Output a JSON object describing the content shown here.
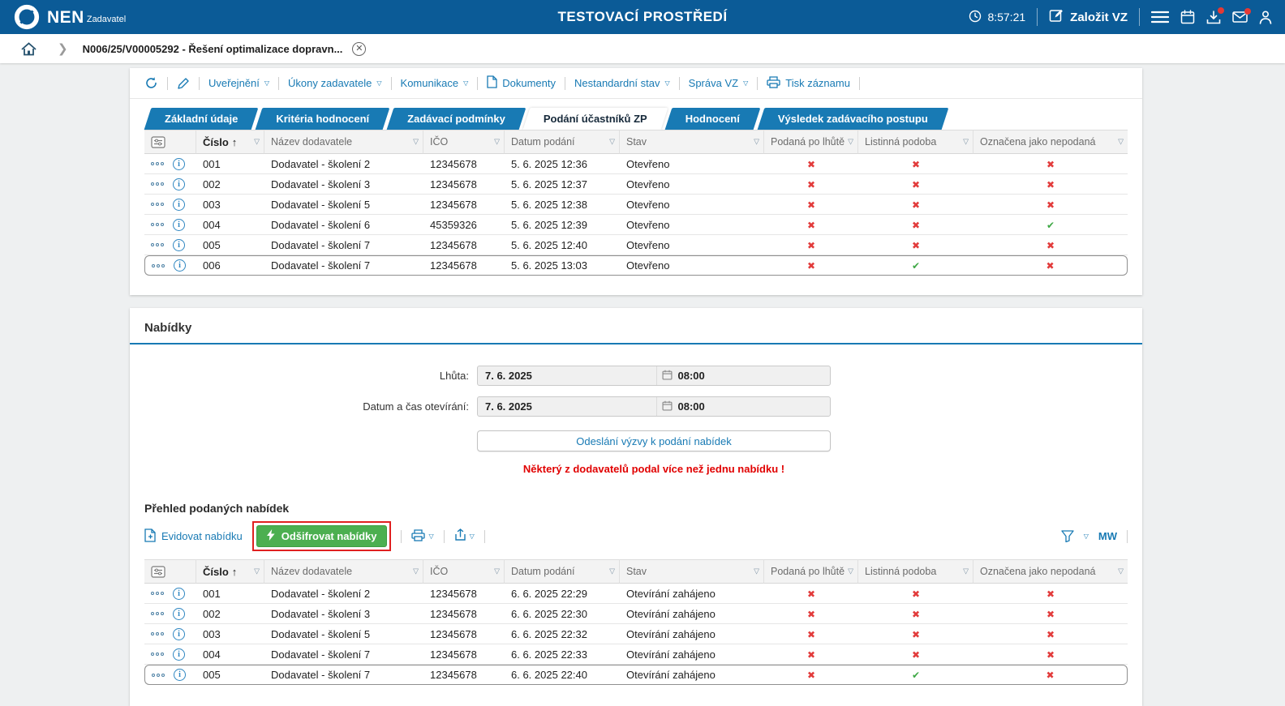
{
  "topbar": {
    "brand": "NEN",
    "brand_sub": "Zadavatel",
    "env_title": "TESTOVACÍ PROSTŘEDÍ",
    "time": "8:57:21",
    "create_vz_label": "Založit VZ"
  },
  "breadcrumb": {
    "record_title": "N006/25/V00005292 - Řešení optimalizace dopravn..."
  },
  "record_toolbar": {
    "items": [
      {
        "label": "Uveřejnění",
        "dropdown": true
      },
      {
        "label": "Úkony zadavatele",
        "dropdown": true
      },
      {
        "label": "Komunikace",
        "dropdown": true
      },
      {
        "label": "Dokumenty",
        "dropdown": false
      },
      {
        "label": "Nestandardní stav",
        "dropdown": true
      },
      {
        "label": "Správa VZ",
        "dropdown": true
      },
      {
        "label": "Tisk záznamu",
        "dropdown": false
      }
    ]
  },
  "tabs": [
    {
      "label": "Základní údaje",
      "active": false
    },
    {
      "label": "Kritéria hodnocení",
      "active": false
    },
    {
      "label": "Zadávací podmínky",
      "active": false
    },
    {
      "label": "Podání účastníků ZP",
      "active": true
    },
    {
      "label": "Hodnocení",
      "active": false
    },
    {
      "label": "Výsledek zadávacího postupu",
      "active": false
    }
  ],
  "headers": [
    "Číslo",
    "Název dodavatele",
    "IČO",
    "Datum podání",
    "Stav",
    "Podaná po lhůtě",
    "Listinná podoba",
    "Označena jako nepodaná"
  ],
  "participants_table": {
    "rows": [
      {
        "number": "001",
        "supplier": "Dodavatel - školení 2",
        "ico": "12345678",
        "submitted": "5. 6. 2025 12:36",
        "status": "Otevřeno",
        "late": false,
        "paper": false,
        "not_submitted": false,
        "selected": false
      },
      {
        "number": "002",
        "supplier": "Dodavatel - školení 3",
        "ico": "12345678",
        "submitted": "5. 6. 2025 12:37",
        "status": "Otevřeno",
        "late": false,
        "paper": false,
        "not_submitted": false,
        "selected": false
      },
      {
        "number": "003",
        "supplier": "Dodavatel - školení 5",
        "ico": "12345678",
        "submitted": "5. 6. 2025 12:38",
        "status": "Otevřeno",
        "late": false,
        "paper": false,
        "not_submitted": false,
        "selected": false
      },
      {
        "number": "004",
        "supplier": "Dodavatel - školení 6",
        "ico": "45359326",
        "submitted": "5. 6. 2025 12:39",
        "status": "Otevřeno",
        "late": false,
        "paper": false,
        "not_submitted": true,
        "selected": false
      },
      {
        "number": "005",
        "supplier": "Dodavatel - školení 7",
        "ico": "12345678",
        "submitted": "5. 6. 2025 12:40",
        "status": "Otevřeno",
        "late": false,
        "paper": false,
        "not_submitted": false,
        "selected": false
      },
      {
        "number": "006",
        "supplier": "Dodavatel - školení 7",
        "ico": "12345678",
        "submitted": "5. 6. 2025 13:03",
        "status": "Otevřeno",
        "late": false,
        "paper": true,
        "not_submitted": false,
        "selected": true
      }
    ]
  },
  "offers_section": {
    "title": "Nabídky",
    "deadline_label": "Lhůta:",
    "deadline_date": "7. 6. 2025",
    "deadline_time": "08:00",
    "opening_label": "Datum a čas otevírání:",
    "opening_date": "7. 6. 2025",
    "opening_time": "08:00",
    "send_invitation_label": "Odeslání výzvy k podání nabídek",
    "warning": "Některý z dodavatelů podal více než jednu nabídku !"
  },
  "submitted_offers": {
    "title": "Přehled podaných nabídek",
    "register_label": "Evidovat nabídku",
    "decrypt_label": "Odšifrovat nabídky",
    "mw_label": "MW",
    "rows": [
      {
        "number": "001",
        "supplier": "Dodavatel - školení 2",
        "ico": "12345678",
        "submitted": "6. 6. 2025 22:29",
        "status": "Otevírání zahájeno",
        "late": false,
        "paper": false,
        "not_submitted": false,
        "selected": false
      },
      {
        "number": "002",
        "supplier": "Dodavatel - školení 3",
        "ico": "12345678",
        "submitted": "6. 6. 2025 22:30",
        "status": "Otevírání zahájeno",
        "late": false,
        "paper": false,
        "not_submitted": false,
        "selected": false
      },
      {
        "number": "003",
        "supplier": "Dodavatel - školení 5",
        "ico": "12345678",
        "submitted": "6. 6. 2025 22:32",
        "status": "Otevírání zahájeno",
        "late": false,
        "paper": false,
        "not_submitted": false,
        "selected": false
      },
      {
        "number": "004",
        "supplier": "Dodavatel - školení 7",
        "ico": "12345678",
        "submitted": "6. 6. 2025 22:33",
        "status": "Otevírání zahájeno",
        "late": false,
        "paper": false,
        "not_submitted": false,
        "selected": false
      },
      {
        "number": "005",
        "supplier": "Dodavatel - školení 7",
        "ico": "12345678",
        "submitted": "6. 6. 2025 22:40",
        "status": "Otevírání zahájeno",
        "late": false,
        "paper": true,
        "not_submitted": false,
        "selected": true
      }
    ]
  },
  "colors": {
    "topbar_blue": "#0b5b97",
    "link_blue": "#187ab4",
    "cross_red": "#e23b3b",
    "check_green": "#3fa845",
    "decrypt_green": "#4caf50",
    "warning_red": "#e10000",
    "annotation_red": "#e02020"
  }
}
